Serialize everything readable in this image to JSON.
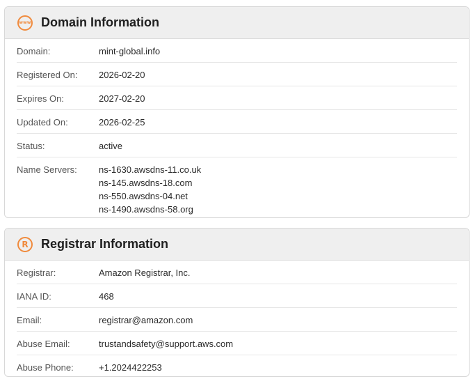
{
  "domain_card": {
    "title": "Domain Information",
    "icon": "www-globe-icon",
    "rows": [
      {
        "label": "Domain:",
        "value": "mint-global.info"
      },
      {
        "label": "Registered On:",
        "value": "2026-02-20"
      },
      {
        "label": "Expires On:",
        "value": "2027-02-20"
      },
      {
        "label": "Updated On:",
        "value": "2026-02-25"
      },
      {
        "label": "Status:",
        "value": "active"
      }
    ],
    "name_servers": {
      "label": "Name Servers:",
      "values": [
        "ns-1630.awsdns-11.co.uk",
        "ns-145.awsdns-18.com",
        "ns-550.awsdns-04.net",
        "ns-1490.awsdns-58.org"
      ]
    }
  },
  "registrar_card": {
    "title": "Registrar Information",
    "icon": "registered-trademark-icon",
    "rows": [
      {
        "label": "Registrar:",
        "value": "Amazon Registrar, Inc."
      },
      {
        "label": "IANA ID:",
        "value": "468"
      },
      {
        "label": "Email:",
        "value": "registrar@amazon.com"
      },
      {
        "label": "Abuse Email:",
        "value": "trustandsafety@support.aws.com"
      },
      {
        "label": "Abuse Phone:",
        "value": "+1.2024422253"
      }
    ]
  },
  "colors": {
    "accent": "#f08a3c",
    "header_bg": "#efefef",
    "border": "#d8d8d8"
  }
}
